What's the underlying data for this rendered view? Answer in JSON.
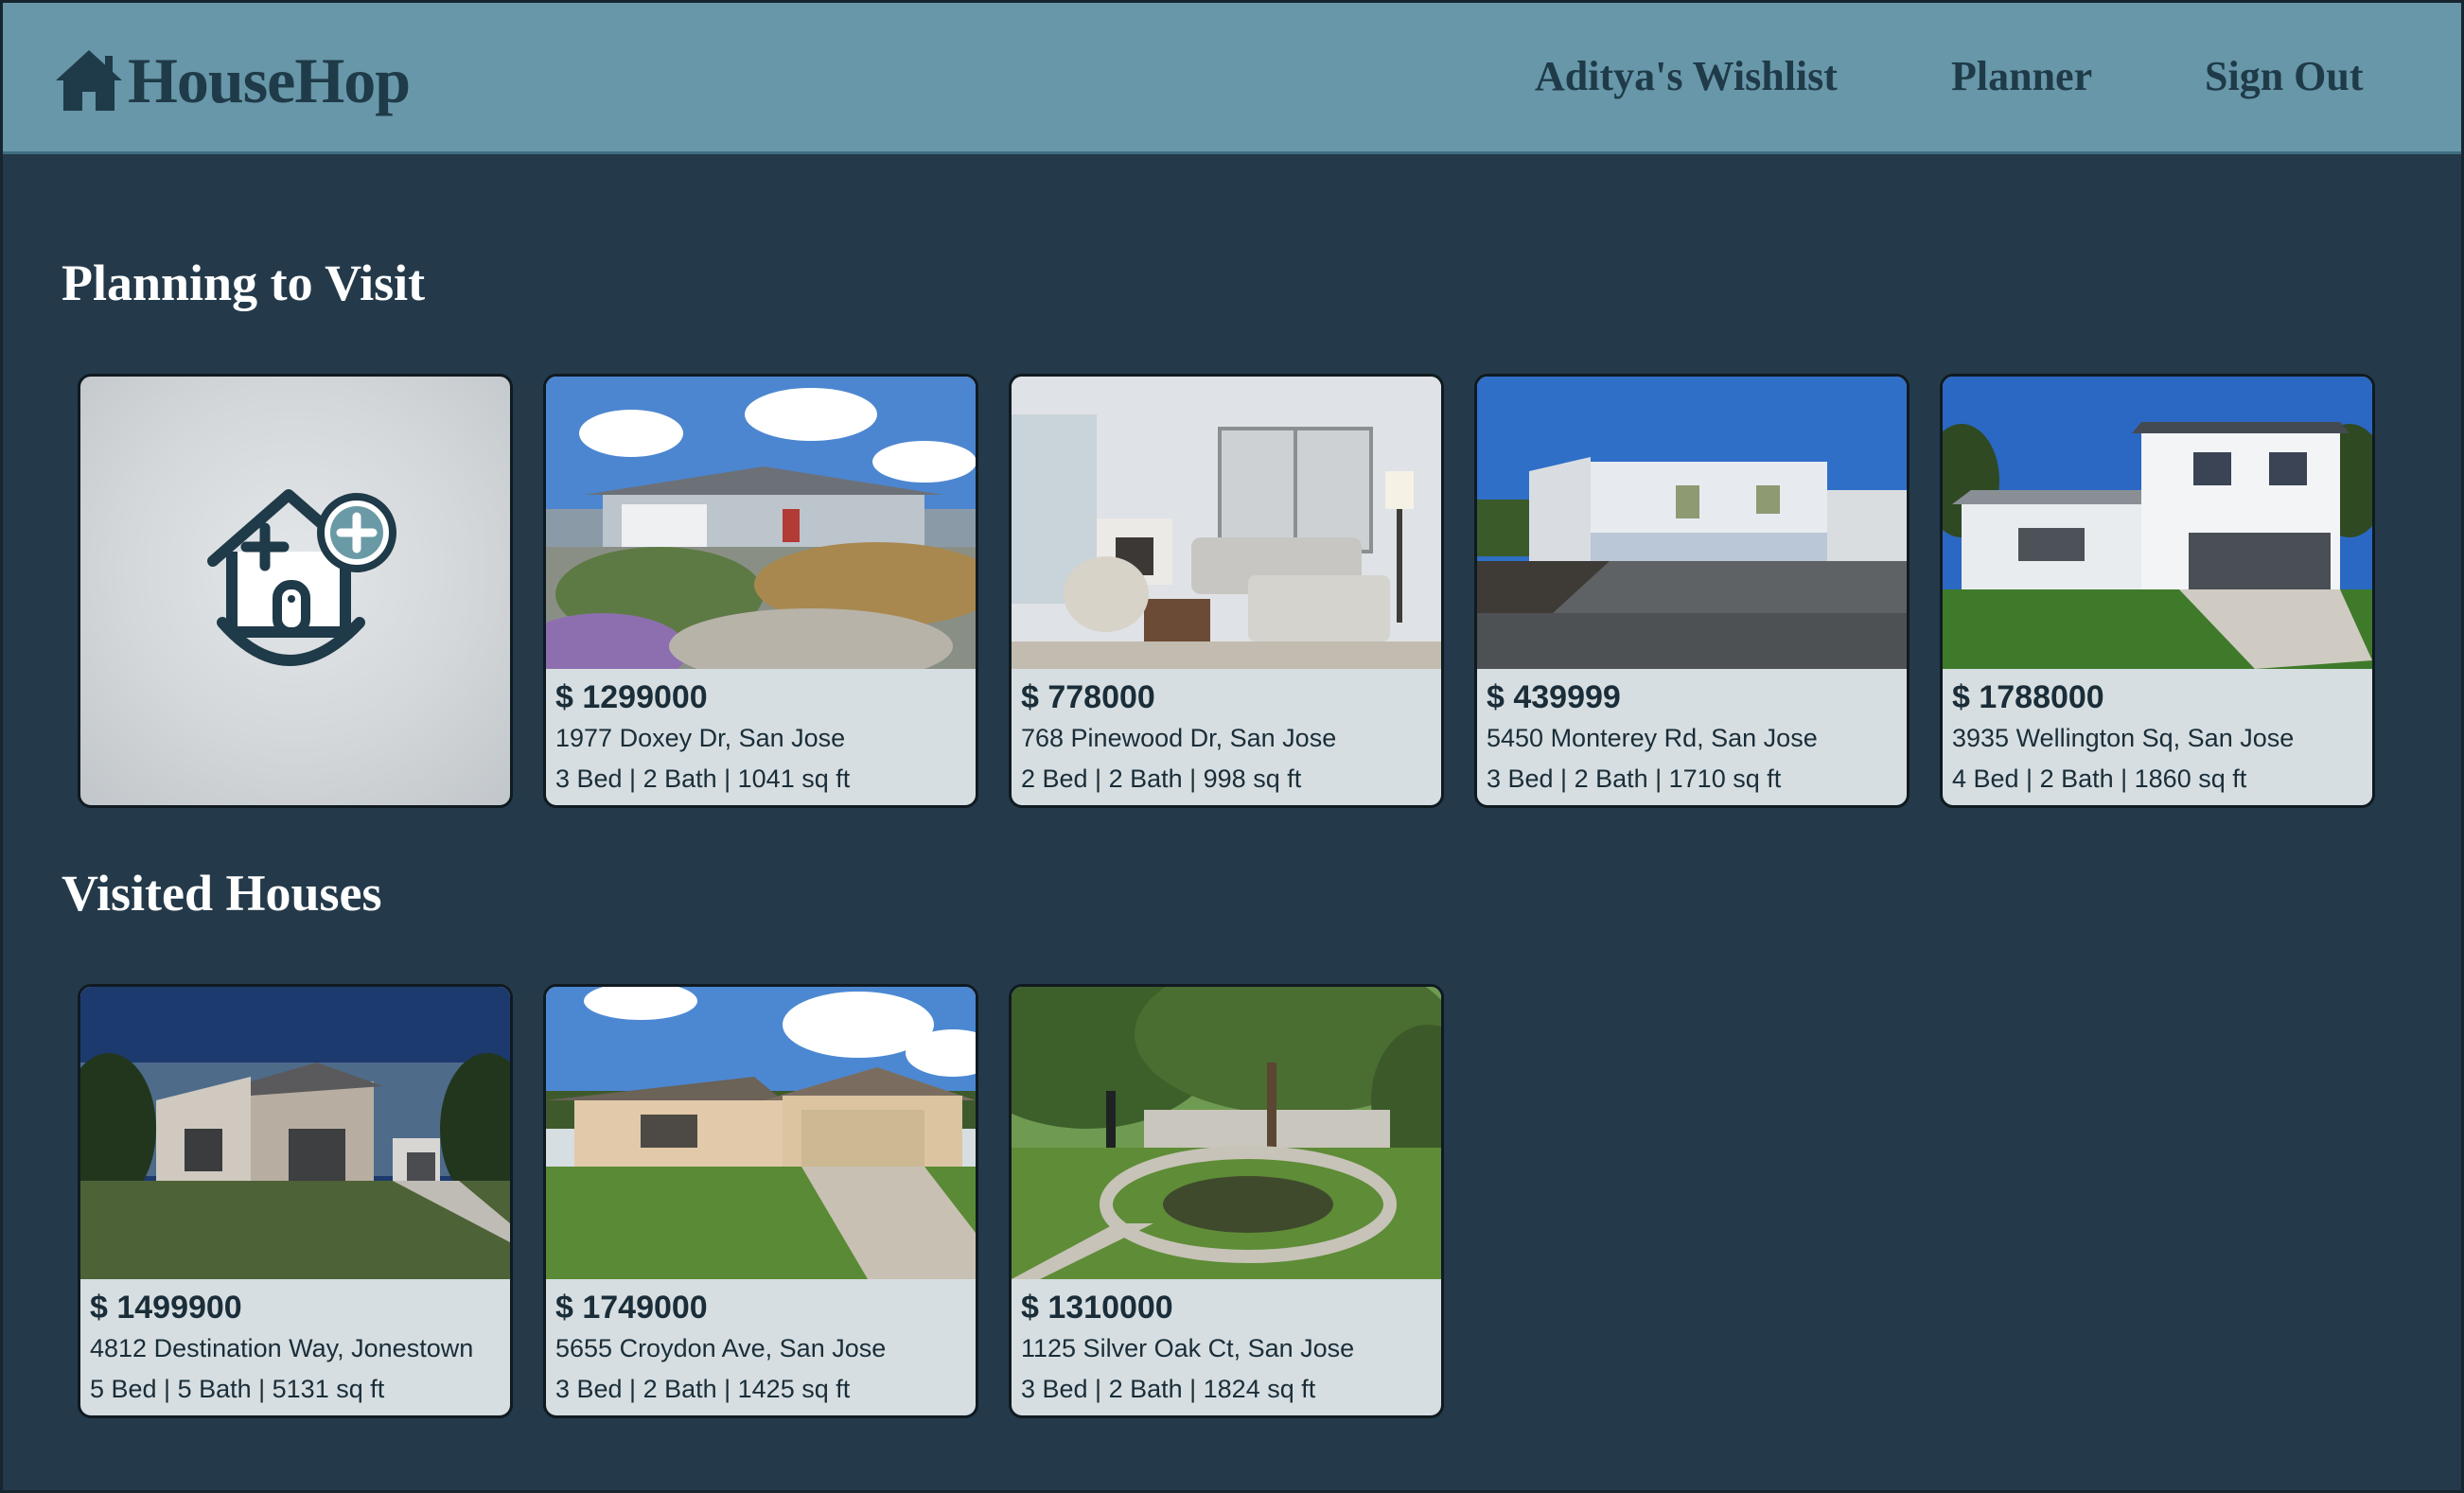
{
  "header": {
    "brand": "HouseHop",
    "nav": {
      "wishlist": "Aditya's Wishlist",
      "planner": "Planner",
      "sign_out": "Sign Out"
    }
  },
  "sections": {
    "planning": {
      "title": "Planning to Visit",
      "cards": [
        {
          "price": "$ 1299000",
          "address": "1977 Doxey Dr, San Jose",
          "specs": "3 Bed | 2 Bath | 1041 sq ft"
        },
        {
          "price": "$ 778000",
          "address": "768 Pinewood Dr, San Jose",
          "specs": "2 Bed | 2 Bath | 998 sq ft"
        },
        {
          "price": "$ 439999",
          "address": "5450 Monterey Rd, San Jose",
          "specs": "3 Bed | 2 Bath | 1710 sq ft"
        },
        {
          "price": "$ 1788000",
          "address": "3935 Wellington Sq, San Jose",
          "specs": "4 Bed | 2 Bath | 1860 sq ft"
        }
      ]
    },
    "visited": {
      "title": "Visited Houses",
      "cards": [
        {
          "price": "$ 1499900",
          "address": "4812 Destination Way, Jonestown",
          "specs": "5 Bed | 5 Bath | 5131 sq ft"
        },
        {
          "price": "$ 1749000",
          "address": "5655 Croydon Ave, San Jose",
          "specs": "3 Bed | 2 Bath | 1425 sq ft"
        },
        {
          "price": "$ 1310000",
          "address": "1125 Silver Oak Ct, San Jose",
          "specs": "3 Bed | 2 Bath | 1824 sq ft"
        }
      ]
    }
  },
  "icons": {
    "brand": "house-icon",
    "add_card": "add-house-icon"
  },
  "colors": {
    "header_bg": "#6797a8",
    "page_bg": "#243a4a",
    "card_bg": "#d6dee1",
    "text_dark": "#1f3a48"
  }
}
